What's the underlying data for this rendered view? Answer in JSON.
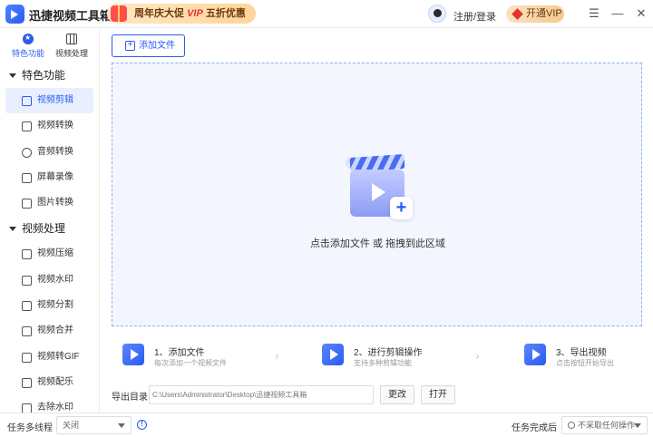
{
  "app": {
    "title": "迅捷视频工具箱"
  },
  "promo": {
    "text_prefix": "周年庆大促",
    "vip": "VIP",
    "text_suffix": "五折优惠"
  },
  "header": {
    "login": "注册/登录",
    "vip_button": "开通VIP",
    "menu_icon": "menu-icon",
    "minimize_icon": "minimize-icon",
    "close_icon": "close-icon"
  },
  "sidebar": {
    "tabs": [
      {
        "label": "特色功能",
        "icon": "star-icon"
      },
      {
        "label": "视频处理",
        "icon": "film-icon"
      }
    ],
    "groups": [
      {
        "label": "特色功能",
        "items": [
          "视频剪辑",
          "视频转换",
          "音频转换",
          "屏幕录像",
          "图片转换"
        ]
      },
      {
        "label": "视频处理",
        "items": [
          "视频压缩",
          "视频水印",
          "视频分割",
          "视频合并",
          "视频转GIF",
          "视频配乐",
          "去除水印"
        ]
      }
    ],
    "active_item": "视频剪辑"
  },
  "main": {
    "add_file": "添加文件",
    "drop_text": "点击添加文件 或 拖拽到此区域",
    "steps": [
      {
        "title": "1、添加文件",
        "sub": "每次添加一个视频文件"
      },
      {
        "title": "2、进行剪辑操作",
        "sub": "支持多种剪辑功能"
      },
      {
        "title": "3、导出视频",
        "sub": "点击按钮开始导出"
      }
    ],
    "export": {
      "label": "导出目录",
      "path": "C:\\Users\\Administrator\\Desktop\\迅捷视频工具箱",
      "change": "更改",
      "open": "打开"
    }
  },
  "status": {
    "multitask_label": "任务多线程",
    "multitask_value": "关闭",
    "complete_label": "任务完成后",
    "complete_value": "不采取任何操作"
  },
  "colors": {
    "accent": "#2a5bf0",
    "dropzone_bg": "#f3f6ff"
  }
}
